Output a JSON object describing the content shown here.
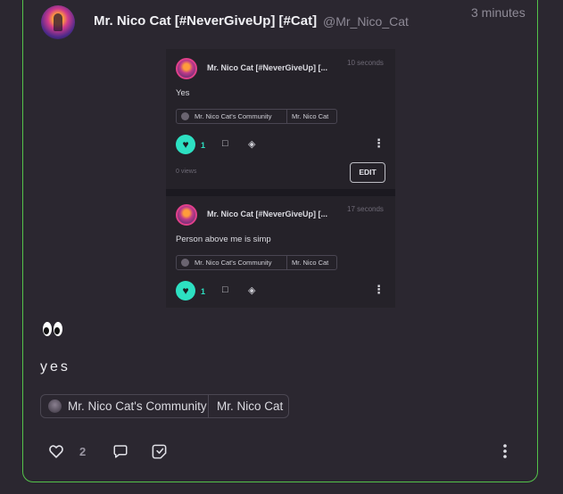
{
  "post": {
    "author_name": "Mr. Nico Cat [#NeverGiveUp] [#Cat]",
    "author_handle": "@Mr_Nico_Cat",
    "time": "3 minutes",
    "text": "yes",
    "likes": "2",
    "tags": [
      "Mr. Nico Cat's Community",
      "Mr. Nico Cat"
    ]
  },
  "embedded": {
    "post1": {
      "author": "Mr. Nico Cat [#NeverGiveUp] [...",
      "time": "10 seconds",
      "text": "Yes",
      "tags": [
        "Mr. Nico Cat's Community",
        "Mr. Nico Cat"
      ],
      "likes": "1",
      "views": "0 views",
      "edit_label": "EDIT"
    },
    "post2": {
      "author": "Mr. Nico Cat [#NeverGiveUp] [...",
      "time": "17 seconds",
      "text": "Person above me is simp",
      "tags": [
        "Mr. Nico Cat's Community",
        "Mr. Nico Cat"
      ],
      "likes": "1"
    }
  },
  "icons": {
    "like": "heart-icon",
    "comment": "comment-icon",
    "share": "share-icon",
    "more": "more-vertical-icon",
    "emoji": "eyes-emoji"
  },
  "colors": {
    "accent": "#2de0c2",
    "card_border": "#54c24a",
    "background": "#2b2730"
  }
}
